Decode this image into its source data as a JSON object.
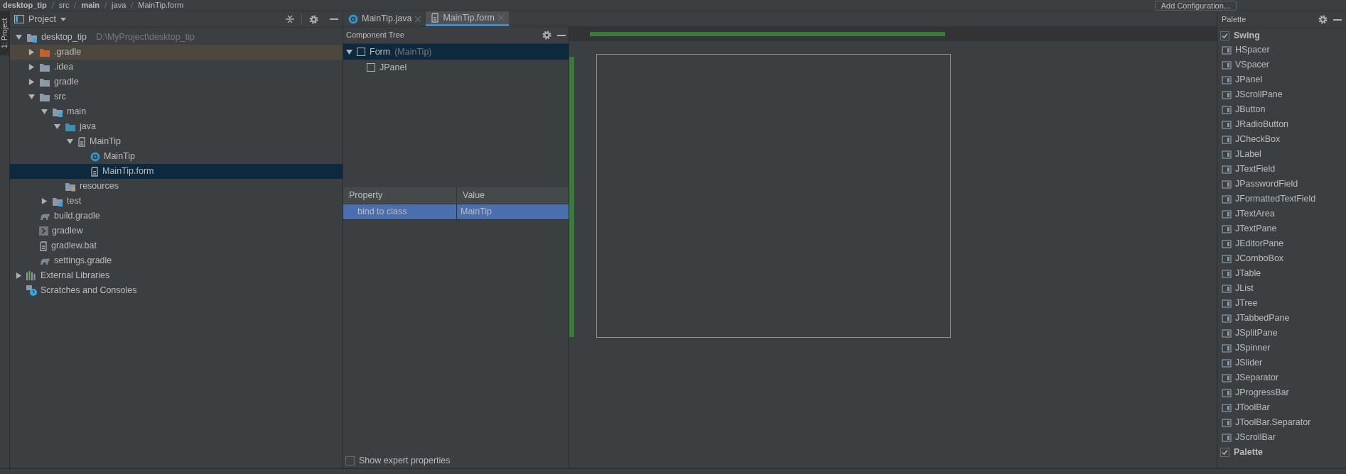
{
  "navbar": {
    "breadcrumbs": [
      "desktop_tip",
      "src",
      "main",
      "java",
      "MainTip.form"
    ],
    "run_config": "Add Configuration..."
  },
  "side_stripe": {
    "tab": "1: Project"
  },
  "project_panel": {
    "title": "Project",
    "tree": [
      {
        "label": "desktop_tip",
        "hint": "D:\\MyProject\\desktop_tip",
        "kind": "module",
        "expanded": true,
        "selected": false,
        "children": [
          {
            "label": ".gradle",
            "kind": "excluded",
            "expanded": false,
            "selected": false,
            "highlighted": true
          },
          {
            "label": ".idea",
            "kind": "folder",
            "expanded": false,
            "selected": false
          },
          {
            "label": "gradle",
            "kind": "folder",
            "expanded": false,
            "selected": false
          },
          {
            "label": "src",
            "kind": "folder",
            "expanded": true,
            "selected": false,
            "children": [
              {
                "label": "main",
                "kind": "module",
                "expanded": true,
                "selected": false,
                "children": [
                  {
                    "label": "java",
                    "kind": "source",
                    "expanded": true,
                    "selected": false,
                    "children": [
                      {
                        "label": "MainTip",
                        "kind": "form",
                        "expanded": true,
                        "selected": false,
                        "children": [
                          {
                            "label": "MainTip",
                            "kind": "class",
                            "selected": false
                          },
                          {
                            "label": "MainTip.form",
                            "kind": "form",
                            "selected": true
                          }
                        ]
                      }
                    ]
                  },
                  {
                    "label": "resources",
                    "kind": "resources",
                    "selected": false
                  }
                ]
              },
              {
                "label": "test",
                "kind": "module",
                "expanded": false,
                "selected": false
              }
            ]
          },
          {
            "label": "build.gradle",
            "kind": "gradle",
            "selected": false
          },
          {
            "label": "gradlew",
            "kind": "script",
            "selected": false
          },
          {
            "label": "gradlew.bat",
            "kind": "file",
            "selected": false
          },
          {
            "label": "settings.gradle",
            "kind": "gradle",
            "selected": false
          }
        ]
      },
      {
        "label": "External Libraries",
        "kind": "libraries",
        "expanded": false,
        "selected": false
      },
      {
        "label": "Scratches and Consoles",
        "kind": "scratches",
        "selected": false
      }
    ]
  },
  "editor_tabs": [
    {
      "label": "MainTip.java",
      "kind": "class",
      "selected": false
    },
    {
      "label": "MainTip.form",
      "kind": "form",
      "selected": true
    }
  ],
  "component_tree": {
    "title": "Component Tree",
    "items": [
      {
        "label": "Form",
        "hint": "(MainTip)",
        "expanded": true,
        "selected": true,
        "children": [
          {
            "label": "JPanel",
            "selected": false
          }
        ]
      }
    ]
  },
  "properties": {
    "columns": [
      "Property",
      "Value"
    ],
    "rows": [
      {
        "property": "bind to class",
        "value": "MainTip",
        "selected": true
      }
    ],
    "show_expert": {
      "label": "Show expert properties",
      "checked": false
    }
  },
  "palette": {
    "title": "Palette",
    "groups": [
      {
        "label": "Swing",
        "checked": true,
        "items": [
          "HSpacer",
          "VSpacer",
          "JPanel",
          "JScrollPane",
          "JButton",
          "JRadioButton",
          "JCheckBox",
          "JLabel",
          "JTextField",
          "JPasswordField",
          "JFormattedTextField",
          "JTextArea",
          "JTextPane",
          "JEditorPane",
          "JComboBox",
          "JTable",
          "JList",
          "JTree",
          "JTabbedPane",
          "JSplitPane",
          "JSpinner",
          "JSlider",
          "JSeparator",
          "JProgressBar",
          "JToolBar",
          "JToolBar.Separator",
          "JScrollBar"
        ]
      },
      {
        "label": "Palette",
        "checked": true
      }
    ]
  }
}
